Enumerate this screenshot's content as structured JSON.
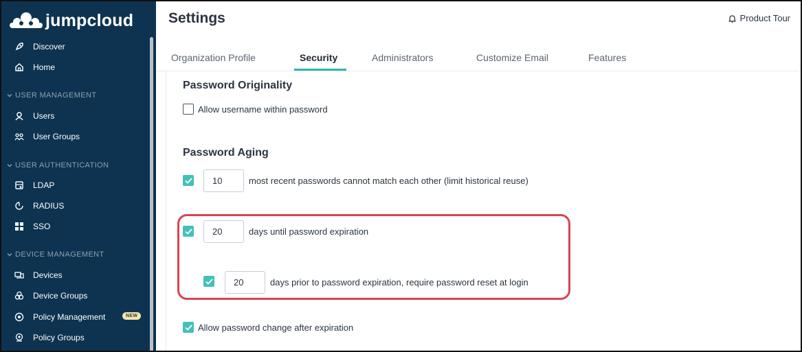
{
  "app": {
    "logo_text": "jumpcloud"
  },
  "sidebar": {
    "items": [
      {
        "label": "Discover",
        "icon": "rocket-icon"
      },
      {
        "label": "Home",
        "icon": "home-icon"
      },
      {
        "label": "Users",
        "icon": "user-icon"
      },
      {
        "label": "User Groups",
        "icon": "user-groups-icon"
      },
      {
        "label": "LDAP",
        "icon": "ldap-icon"
      },
      {
        "label": "RADIUS",
        "icon": "radius-icon"
      },
      {
        "label": "SSO",
        "icon": "sso-grid-icon"
      },
      {
        "label": "Devices",
        "icon": "devices-icon"
      },
      {
        "label": "Device Groups",
        "icon": "device-groups-icon"
      },
      {
        "label": "Policy Management",
        "icon": "policy-icon",
        "badge": "NEW"
      },
      {
        "label": "Policy Groups",
        "icon": "policy-groups-icon"
      }
    ],
    "sections": [
      {
        "label": "USER MANAGEMENT"
      },
      {
        "label": "USER AUTHENTICATION"
      },
      {
        "label": "DEVICE MANAGEMENT"
      }
    ]
  },
  "header": {
    "title": "Settings",
    "product_tour": "Product Tour"
  },
  "tabs": [
    {
      "label": "Organization Profile",
      "active": false
    },
    {
      "label": "Security",
      "active": true
    },
    {
      "label": "Administrators",
      "active": false
    },
    {
      "label": "Customize Email",
      "active": false
    },
    {
      "label": "Features",
      "active": false
    }
  ],
  "security": {
    "originality_title": "Password Originality",
    "allow_username": {
      "label": "Allow username within password",
      "checked": false
    },
    "aging_title": "Password Aging",
    "history": {
      "value": "10",
      "label": "most recent passwords cannot match each other (limit historical reuse)",
      "checked": true
    },
    "expiration": {
      "value": "20",
      "label": "days until password expiration",
      "checked": true
    },
    "reset_prior": {
      "value": "20",
      "label": "days prior to password expiration, require password reset at login",
      "checked": true
    },
    "allow_change": {
      "label": "Allow password change after expiration",
      "checked": true
    }
  },
  "colors": {
    "sidebar_bg": "#0d3350",
    "accent": "#2fb5a8",
    "checkbox_on": "#43c1b7",
    "highlight": "#d9434f"
  }
}
